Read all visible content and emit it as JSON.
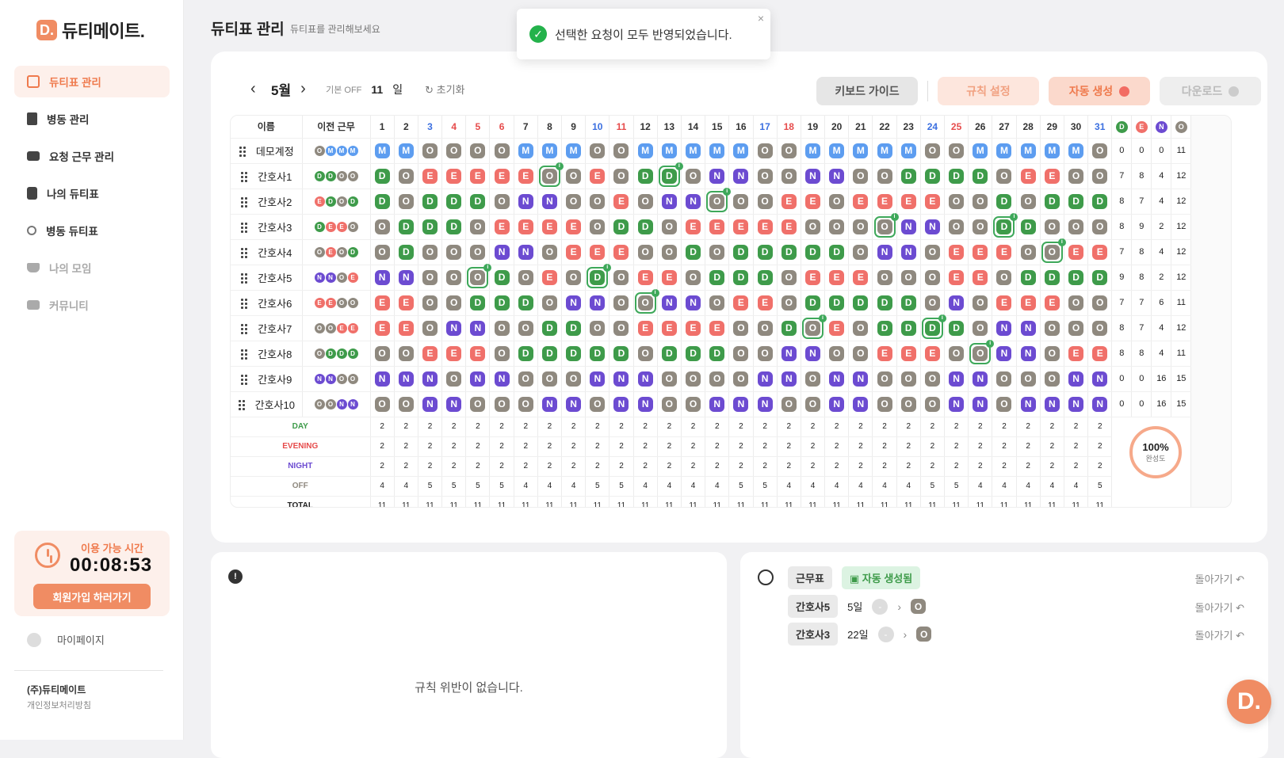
{
  "brand": {
    "logo_letter": "D.",
    "name": "듀티메이트."
  },
  "nav": [
    {
      "label": "듀티표 관리",
      "icon": "calendar-icon",
      "active": true
    },
    {
      "label": "병동 관리",
      "icon": "building-icon"
    },
    {
      "label": "요청 근무 관리",
      "icon": "inbox-icon"
    },
    {
      "label": "나의 듀티표",
      "icon": "document-icon"
    },
    {
      "label": "병동 듀티표",
      "icon": "users-icon"
    },
    {
      "label": "나의 모임",
      "icon": "cup-icon",
      "disabled": true
    },
    {
      "label": "커뮤니티",
      "icon": "chat-icon",
      "disabled": true
    }
  ],
  "timer": {
    "label": "이용 가능 시간",
    "value": "00:08:53",
    "button": "회원가입 하러가기"
  },
  "mypage": "마이페이지",
  "footer": {
    "company": "(주)듀티메이트",
    "privacy": "개인정보처리방침"
  },
  "header": {
    "title": "듀티표 관리",
    "subtitle": "듀티표를 관리해보세요"
  },
  "toast": {
    "message": "선택한 요청이 모두 반영되었습니다.",
    "close": "×"
  },
  "toolbar": {
    "month": "5월",
    "off_label": "기본 OFF",
    "off_value": "11",
    "off_unit": "일",
    "reset": "초기화",
    "guide": "키보드 가이드",
    "rules": "규칙 설정",
    "auto": "자동 생성",
    "download": "다운로드"
  },
  "table": {
    "col_name": "이름",
    "col_prev": "이전 근무",
    "days": [
      "1",
      "2",
      "3",
      "4",
      "5",
      "6",
      "7",
      "8",
      "9",
      "10",
      "11",
      "12",
      "13",
      "14",
      "15",
      "16",
      "17",
      "18",
      "19",
      "20",
      "21",
      "22",
      "23",
      "24",
      "25",
      "26",
      "27",
      "28",
      "29",
      "30",
      "31"
    ],
    "sat": [
      "3",
      "10",
      "17",
      "24",
      "31"
    ],
    "sun": [
      "4",
      "5",
      "6",
      "11",
      "18",
      "25"
    ],
    "sum_headers": [
      "D",
      "E",
      "N",
      "O"
    ],
    "rows": [
      {
        "name": "데모계정",
        "prev": "OMMM",
        "shifts": "MMOOOOMMMOOMMMMMOOMMMMMOOMMMMMO",
        "sums": [
          "0",
          "0",
          "0",
          "11"
        ]
      },
      {
        "name": "간호사1",
        "prev": "DDOO",
        "shifts": "DOEEEEEOOEODDONNOONNOODDDDOEEOO",
        "sums": [
          "7",
          "8",
          "4",
          "12"
        ],
        "marks": [
          8,
          13
        ]
      },
      {
        "name": "간호사2",
        "prev": "EDOD",
        "shifts": "DODDDONNOOEONNOOOEEOEEEEOODODDD",
        "sums": [
          "8",
          "7",
          "4",
          "12"
        ],
        "marks": [
          15
        ]
      },
      {
        "name": "간호사3",
        "prev": "DEEO",
        "shifts": "ODDDOEEEEODDOEEEEEOOOONNOODDOOO",
        "sums": [
          "8",
          "9",
          "2",
          "12"
        ],
        "marks": [
          22,
          27
        ]
      },
      {
        "name": "간호사4",
        "prev": "OEOD",
        "shifts": "ODOOONNOEEEOODODDDDDONNOEEEOOEE",
        "sums": [
          "7",
          "8",
          "4",
          "12"
        ],
        "marks": [
          29
        ]
      },
      {
        "name": "간호사5",
        "prev": "NNOE",
        "shifts": "NNOOODOEODOEEODDDOEEEOOOEEODDDD",
        "sums": [
          "9",
          "8",
          "2",
          "12"
        ],
        "marks": [
          5,
          10
        ]
      },
      {
        "name": "간호사6",
        "prev": "EEOO",
        "shifts": "EEOODDDONNOONNOEEODDDDDONOEEEOO",
        "sums": [
          "7",
          "7",
          "6",
          "11"
        ],
        "marks": [
          12
        ]
      },
      {
        "name": "간호사7",
        "prev": "OOEE",
        "shifts": "EEONNOODDOOEEEEOODOEODDDDONNOOO",
        "sums": [
          "8",
          "7",
          "4",
          "12"
        ],
        "marks": [
          19,
          24
        ]
      },
      {
        "name": "간호사8",
        "prev": "ODDD",
        "shifts": "OOEEEODDDDDODDDOONNOOEEEOONNOEE",
        "sums": [
          "8",
          "8",
          "4",
          "11"
        ],
        "marks": [
          26
        ]
      },
      {
        "name": "간호사9",
        "prev": "NNOO",
        "shifts": "NNNONNOOONNNOOOONNONNOOONNOOONN",
        "sums": [
          "0",
          "0",
          "16",
          "15"
        ]
      },
      {
        "name": "간호사10",
        "prev": "OONN",
        "shifts": "OONNOOONNONNOONNNOONNOOONNONNNN",
        "sums": [
          "0",
          "0",
          "16",
          "15"
        ]
      }
    ],
    "stats": [
      {
        "label": "DAY",
        "cls": "d",
        "values": [
          "2",
          "2",
          "2",
          "2",
          "2",
          "2",
          "2",
          "2",
          "2",
          "2",
          "2",
          "2",
          "2",
          "2",
          "2",
          "2",
          "2",
          "2",
          "2",
          "2",
          "2",
          "2",
          "2",
          "2",
          "2",
          "2",
          "2",
          "2",
          "2",
          "2",
          "2"
        ]
      },
      {
        "label": "EVENING",
        "cls": "e",
        "values": [
          "2",
          "2",
          "2",
          "2",
          "2",
          "2",
          "2",
          "2",
          "2",
          "2",
          "2",
          "2",
          "2",
          "2",
          "2",
          "2",
          "2",
          "2",
          "2",
          "2",
          "2",
          "2",
          "2",
          "2",
          "2",
          "2",
          "2",
          "2",
          "2",
          "2",
          "2"
        ]
      },
      {
        "label": "NIGHT",
        "cls": "n",
        "values": [
          "2",
          "2",
          "2",
          "2",
          "2",
          "2",
          "2",
          "2",
          "2",
          "2",
          "2",
          "2",
          "2",
          "2",
          "2",
          "2",
          "2",
          "2",
          "2",
          "2",
          "2",
          "2",
          "2",
          "2",
          "2",
          "2",
          "2",
          "2",
          "2",
          "2",
          "2"
        ]
      },
      {
        "label": "OFF",
        "cls": "o",
        "values": [
          "4",
          "4",
          "5",
          "5",
          "5",
          "5",
          "4",
          "4",
          "4",
          "5",
          "5",
          "4",
          "4",
          "4",
          "4",
          "5",
          "5",
          "4",
          "4",
          "4",
          "4",
          "4",
          "4",
          "5",
          "5",
          "4",
          "4",
          "4",
          "4",
          "4",
          "5"
        ]
      },
      {
        "label": "TOTAL",
        "cls": "t",
        "values": [
          "11",
          "11",
          "11",
          "11",
          "11",
          "11",
          "11",
          "11",
          "11",
          "11",
          "11",
          "11",
          "11",
          "11",
          "11",
          "11",
          "11",
          "11",
          "11",
          "11",
          "11",
          "11",
          "11",
          "11",
          "11",
          "11",
          "11",
          "11",
          "11",
          "11",
          "11"
        ]
      }
    ],
    "completion": {
      "value": "100%",
      "label": "완성도"
    }
  },
  "violations": {
    "empty": "규칙 위반이 없습니다."
  },
  "history": {
    "rows": [
      {
        "chip": "근무표",
        "status": "자동 생성됨",
        "back": "돌아가기 ↶"
      },
      {
        "chip": "간호사5",
        "date": "5일",
        "from": "-",
        "to": "O",
        "back": "돌아가기 ↶"
      },
      {
        "chip": "간호사3",
        "date": "22일",
        "from": "-",
        "to": "O",
        "back": "돌아가기 ↶"
      }
    ]
  },
  "fab": "D.",
  "colors": {
    "accent": "#f08c63",
    "day": "#3e9b4a",
    "evening": "#f0706a",
    "night": "#6c4bd1",
    "off": "#8f897f",
    "mid": "#5d9df0"
  }
}
